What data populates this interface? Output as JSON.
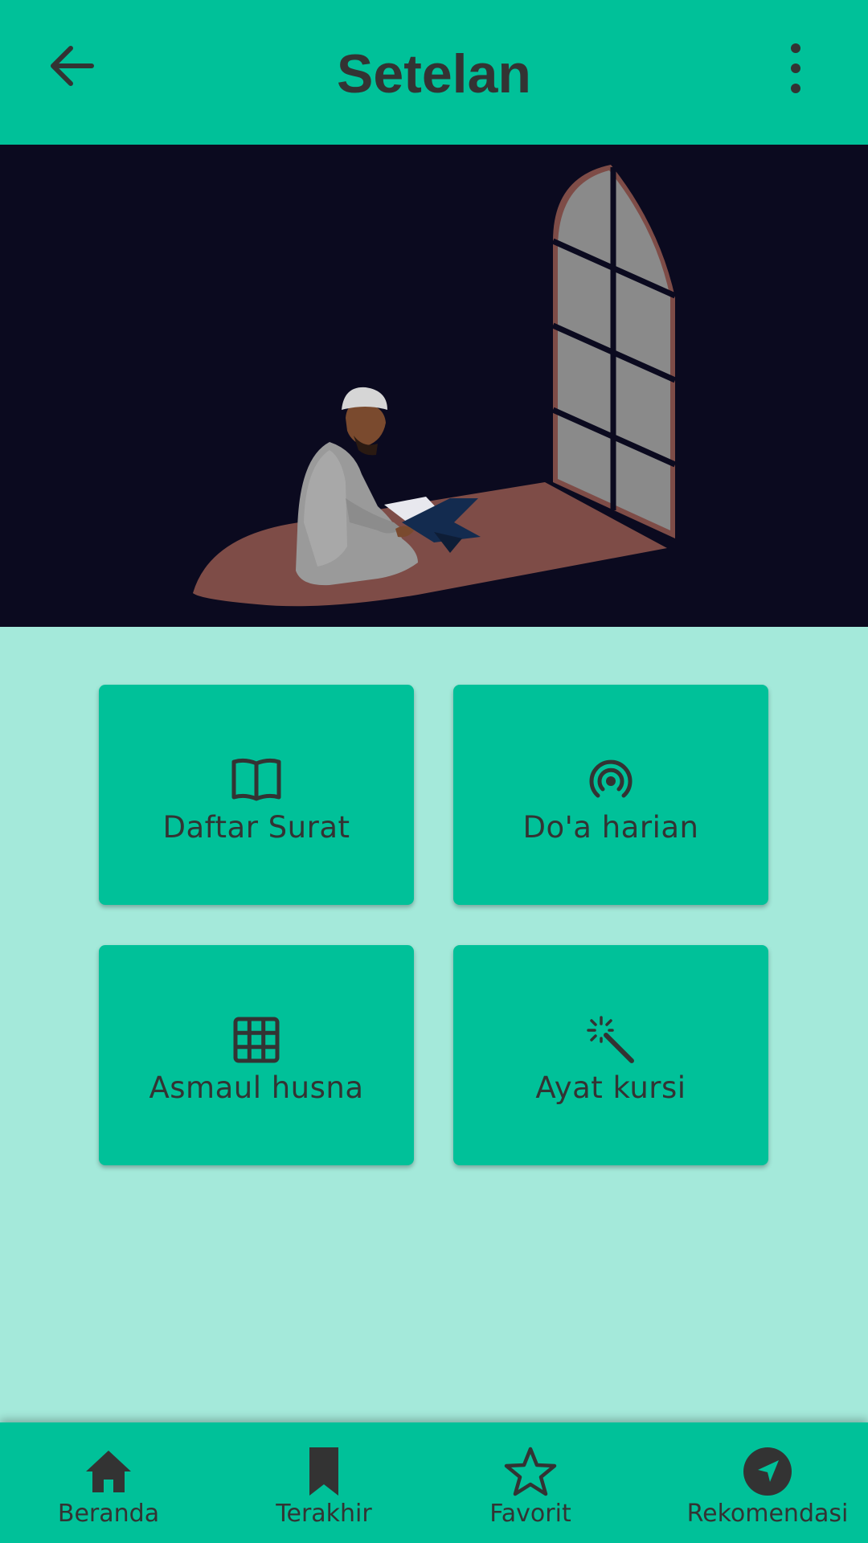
{
  "app_bar": {
    "title": "Setelan",
    "back_icon": "arrow-left-icon",
    "menu_icon": "more-vert-icon",
    "color": "#00c199"
  },
  "menu_cards": [
    {
      "label": "Daftar Surat",
      "icon": "book-open-icon"
    },
    {
      "label": "Do'a harian",
      "icon": "broadcast-icon"
    },
    {
      "label": "Asmaul husna",
      "icon": "grid-icon"
    },
    {
      "label": "Ayat kursi",
      "icon": "magic-wand-icon"
    }
  ],
  "bottom_nav": [
    {
      "label": "Beranda",
      "icon": "home-icon"
    },
    {
      "label": "Terakhir",
      "icon": "bookmark-icon"
    },
    {
      "label": "Favorit",
      "icon": "star-icon"
    },
    {
      "label": "Rekomendasi",
      "icon": "navigation-icon"
    }
  ],
  "colors": {
    "accent": "#00c199",
    "background": "#a4e9da",
    "text": "#333333",
    "hero_background": "#0b0a1f"
  }
}
